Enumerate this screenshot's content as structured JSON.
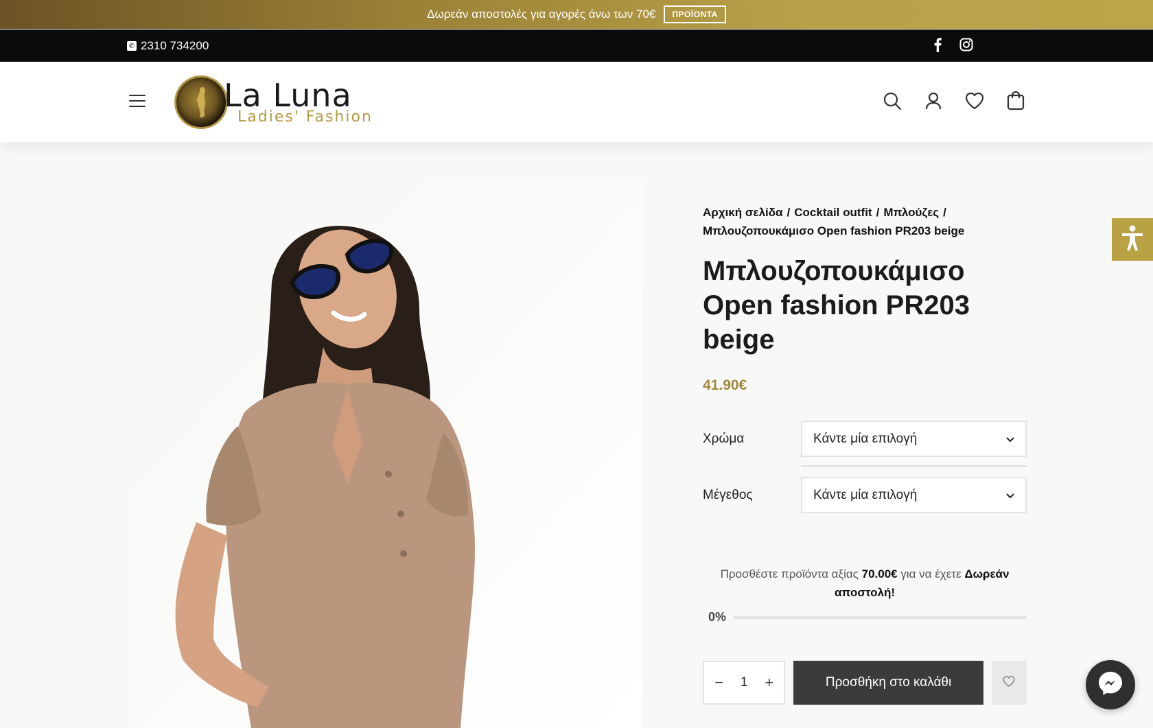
{
  "promo": {
    "text": "Δωρεάν αποστολές για αγορές άνω των 70€",
    "button": "ΠΡΟΪΟΝΤΑ"
  },
  "topbar": {
    "phone": "2310 734200",
    "social": [
      "facebook-icon",
      "instagram-icon"
    ]
  },
  "header": {
    "logo_main": "La Luna",
    "logo_sub": "Ladies' Fashion",
    "icons": [
      "search-icon",
      "user-icon",
      "heart-icon",
      "cart-bag-icon"
    ]
  },
  "breadcrumb": {
    "items": [
      "Αρχική σελίδα",
      "Cocktail outfit",
      "Μπλούζες",
      "Μπλουζοπουκάμισο Open fashion PR203 beige"
    ],
    "separator": "/"
  },
  "product": {
    "title": "Μπλουζοπουκάμισο Open fashion PR203 beige",
    "price": "41.90€"
  },
  "attributes": [
    {
      "label": "Χρώμα",
      "selected": "Κάντε μία επιλογή"
    },
    {
      "label": "Μέγεθος",
      "selected": "Κάντε μία επιλογή"
    }
  ],
  "shipping": {
    "prefix": "Προσθέστε προϊόντα αξίας",
    "amount": "70.00€",
    "middle": "για να έχετε",
    "bold_end": "Δωρεάν αποστολή!",
    "progress_label": "0%",
    "progress_value": 0
  },
  "cart": {
    "quantity": "1",
    "minus": "−",
    "plus": "+",
    "add_label": "Προσθήκη στο καλάθι"
  },
  "colors": {
    "accent_gold": "#a08a3c",
    "dark": "#3b3b3b",
    "access_gold": "#b9a244"
  }
}
